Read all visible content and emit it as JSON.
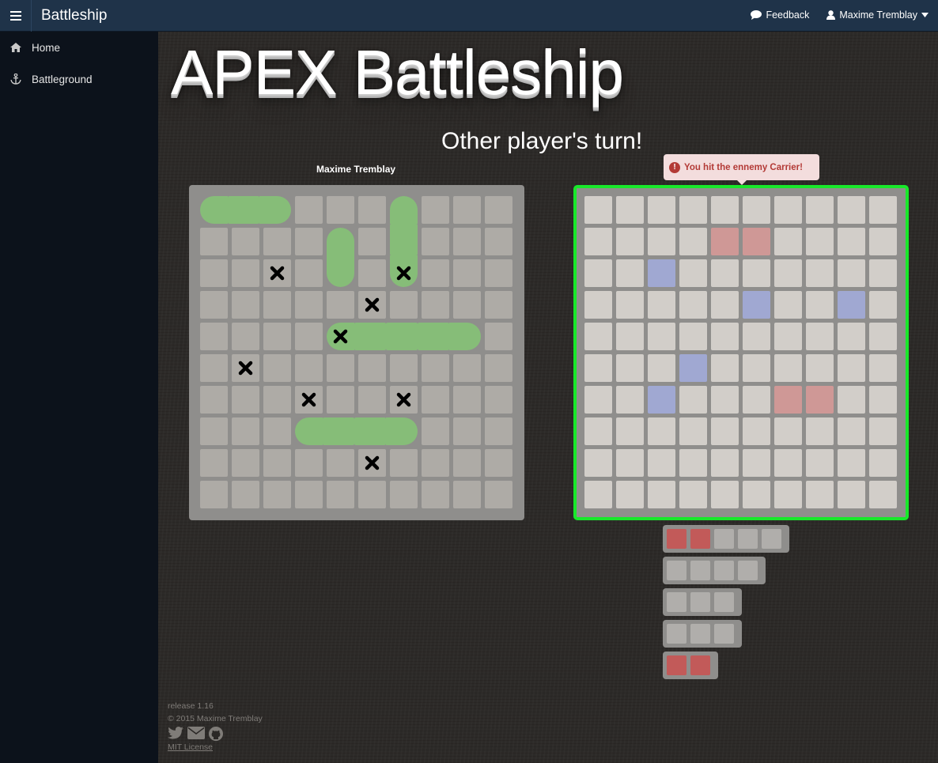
{
  "nav": {
    "brand": "Battleship",
    "feedback": "Feedback",
    "user": "Maxime Tremblay"
  },
  "sidebar": {
    "items": [
      {
        "label": "Home",
        "icon": "home-icon"
      },
      {
        "label": "Battleground",
        "icon": "anchor-icon"
      }
    ]
  },
  "main": {
    "title": "APEX Battleship",
    "status": "Other player's turn!",
    "player_name": "Maxime Tremblay",
    "toast": "You hit the ennemy Carrier!"
  },
  "own_board": {
    "size": 10,
    "ships": [
      {
        "row": 0,
        "col": 0,
        "length": 3,
        "orientation": "horizontal"
      },
      {
        "row": 0,
        "col": 6,
        "length": 3,
        "orientation": "vertical"
      },
      {
        "row": 1,
        "col": 4,
        "length": 2,
        "orientation": "vertical"
      },
      {
        "row": 4,
        "col": 4,
        "length": 5,
        "orientation": "horizontal"
      },
      {
        "row": 7,
        "col": 3,
        "length": 4,
        "orientation": "horizontal"
      }
    ],
    "marks": [
      [
        2,
        2
      ],
      [
        2,
        6
      ],
      [
        3,
        5
      ],
      [
        4,
        4
      ],
      [
        5,
        1
      ],
      [
        6,
        3
      ],
      [
        6,
        6
      ],
      [
        8,
        5
      ]
    ]
  },
  "enemy_board": {
    "size": 10,
    "hits": [
      [
        1,
        4
      ],
      [
        1,
        5
      ],
      [
        6,
        6
      ],
      [
        6,
        7
      ]
    ],
    "misses": [
      [
        2,
        2
      ],
      [
        3,
        5
      ],
      [
        3,
        8
      ],
      [
        5,
        3
      ],
      [
        6,
        2
      ]
    ]
  },
  "fleet": [
    {
      "size": 5,
      "hits": 2
    },
    {
      "size": 4,
      "hits": 0
    },
    {
      "size": 3,
      "hits": 0
    },
    {
      "size": 3,
      "hits": 0
    },
    {
      "size": 2,
      "hits": 2
    }
  ],
  "colors": {
    "ship": "#86bd78",
    "hit": "#cf9896",
    "miss": "#a0a8d2",
    "sunk": "#c25a59",
    "active_border": "#18e82a"
  },
  "footer": {
    "release": "release 1.16",
    "copyright": "© 2015 Maxime Tremblay",
    "license": "MIT License"
  }
}
